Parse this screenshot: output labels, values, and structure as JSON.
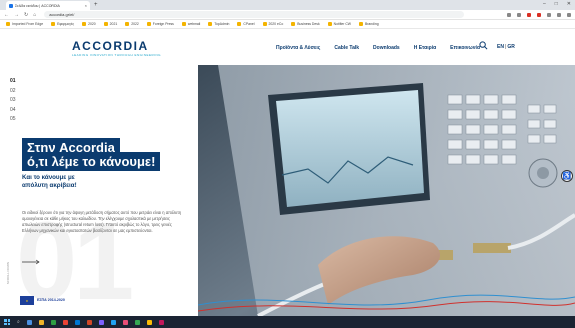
{
  "browser": {
    "tab_title": "Σελίδα εισόδου | ACCORDIA",
    "new_tab": "+",
    "url": "accordia.gr/el/",
    "window_controls": [
      "–",
      "□",
      "✕"
    ],
    "bookmarks": [
      "Imported From Edge",
      "Εφαρμογές",
      "2020",
      "2021",
      "2022",
      "Foreign Press",
      "webmail",
      "TopAdmin",
      "CPanel",
      "2020 eCo",
      "Business Desk",
      "Notifier CW",
      "Branding"
    ]
  },
  "site": {
    "logo": "ACCORDIA",
    "logo_tagline": "LEADING INNOVATION THROUGH ENGINEERING",
    "menu": [
      "Προϊόντα & Λύσεις",
      "Cable Talk",
      "Downloads",
      "Η Εταιρία",
      "Επικοινωνία"
    ],
    "lang_active": "EN",
    "lang_other": "GR",
    "lang_sep": "|"
  },
  "hero": {
    "slides": [
      "01",
      "02",
      "03",
      "04",
      "05"
    ],
    "active_slide": "01",
    "headline_line1": "Στην Accordia",
    "headline_line2": "ό,τι λέμε το κάνουμε!",
    "subhead": "Και το κάνουμε με απόλυτη ακρίβεια!",
    "body": "Οι ειδικοί ξέρουν ότι για την άψογη μετάδοση σήματος αυτό που μετράει είναι η απόλυτη ομοιογένεια σε κάθε μήκος του καλωδίου. Την ελέγχουμε σχολαστικά με μετρήσεις απωλειών επιστροφής (structural return loss). Γι'αυτό ακριβώς το λόγο, τρεις γενιές Ελλήνων μηχανικών και εγκαταστατών βασίζονται σε μας εμπιστεύονται.",
    "big_number": "01",
    "scroll_label": "SCROLL DOWN",
    "espa": "ΕΣΠΑ 2014-2020"
  },
  "colors": {
    "navy": "#0b3b6f",
    "teal": "#1aa3c9"
  }
}
